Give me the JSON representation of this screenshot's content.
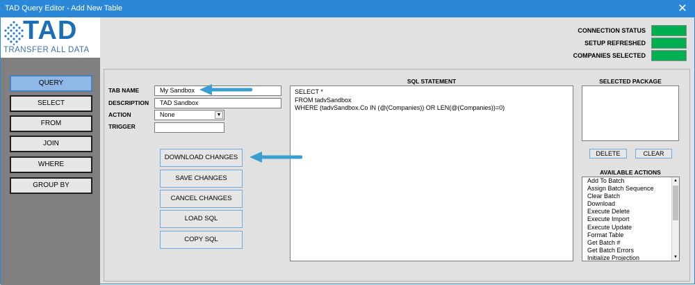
{
  "window": {
    "title": "TAD Query Editor - Add New Table",
    "close": "✕"
  },
  "logo": {
    "brand": "TAD",
    "tagline": "TRANSFER ALL DATA"
  },
  "nav": [
    {
      "label": "QUERY",
      "active": true
    },
    {
      "label": "SELECT",
      "active": false
    },
    {
      "label": "FROM",
      "active": false
    },
    {
      "label": "JOIN",
      "active": false
    },
    {
      "label": "WHERE",
      "active": false
    },
    {
      "label": "GROUP BY",
      "active": false
    }
  ],
  "status": {
    "connection": "CONNECTION STATUS",
    "setup": "SETUP REFRESHED",
    "companies": "COMPANIES SELECTED",
    "indicator_color": "#00b050"
  },
  "form": {
    "tab_name_label": "TAB NAME",
    "tab_name_value": "My Sandbox",
    "description_label": "DESCRIPTION",
    "description_value": "TAD Sandbox",
    "action_label": "ACTION",
    "action_value": "None",
    "trigger_label": "TRIGGER",
    "trigger_value": ""
  },
  "buttons": {
    "download": "DOWNLOAD CHANGES",
    "save": "SAVE CHANGES",
    "cancel": "CANCEL CHANGES",
    "load_sql": "LOAD SQL",
    "copy_sql": "COPY SQL",
    "delete": "DELETE",
    "clear": "CLEAR"
  },
  "sql": {
    "title": "SQL STATEMENT",
    "lines": [
      "SELECT *",
      "FROM tadvSandbox",
      "WHERE (tadvSandbox.Co IN (@(Companies)) OR LEN(@(Companies))=0)"
    ]
  },
  "package": {
    "title": "SELECTED PACKAGE"
  },
  "available_actions": {
    "title": "AVAILABLE ACTIONS",
    "items": [
      "Add To Batch",
      "Assign Batch Sequence",
      "Clear Batch",
      "Download",
      "Execute Delete",
      "Execute Import",
      "Execute Update",
      "Format Table",
      "Get Batch #",
      "Get Batch Errors",
      "Initialize Projection"
    ]
  },
  "colors": {
    "accent": "#2b88d8",
    "status_green": "#00b050",
    "active_nav": "#8fb8e8",
    "callout_arrow": "#3a9fd0"
  }
}
